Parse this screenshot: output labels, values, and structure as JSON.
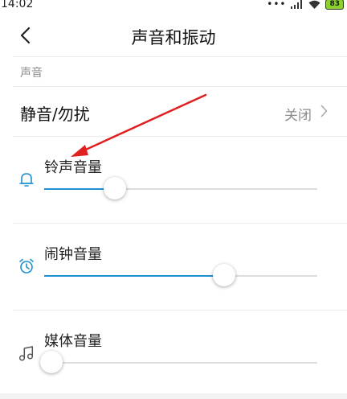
{
  "status_bar": {
    "time": "14:02",
    "battery": "83"
  },
  "header": {
    "title": "声音和振动"
  },
  "section": {
    "label": "声音"
  },
  "dnd": {
    "label": "静音/勿扰",
    "value": "关闭"
  },
  "volumes": [
    {
      "label": "铃声音量",
      "icon": "bell-icon",
      "level": 0.26
    },
    {
      "label": "闹钟音量",
      "icon": "alarm-clock-icon",
      "level": 0.66
    },
    {
      "label": "媒体音量",
      "icon": "music-note-icon",
      "level": 0.025
    }
  ],
  "colors": {
    "accent": "#1e8fd0",
    "annotation_arrow": "#e02020"
  }
}
